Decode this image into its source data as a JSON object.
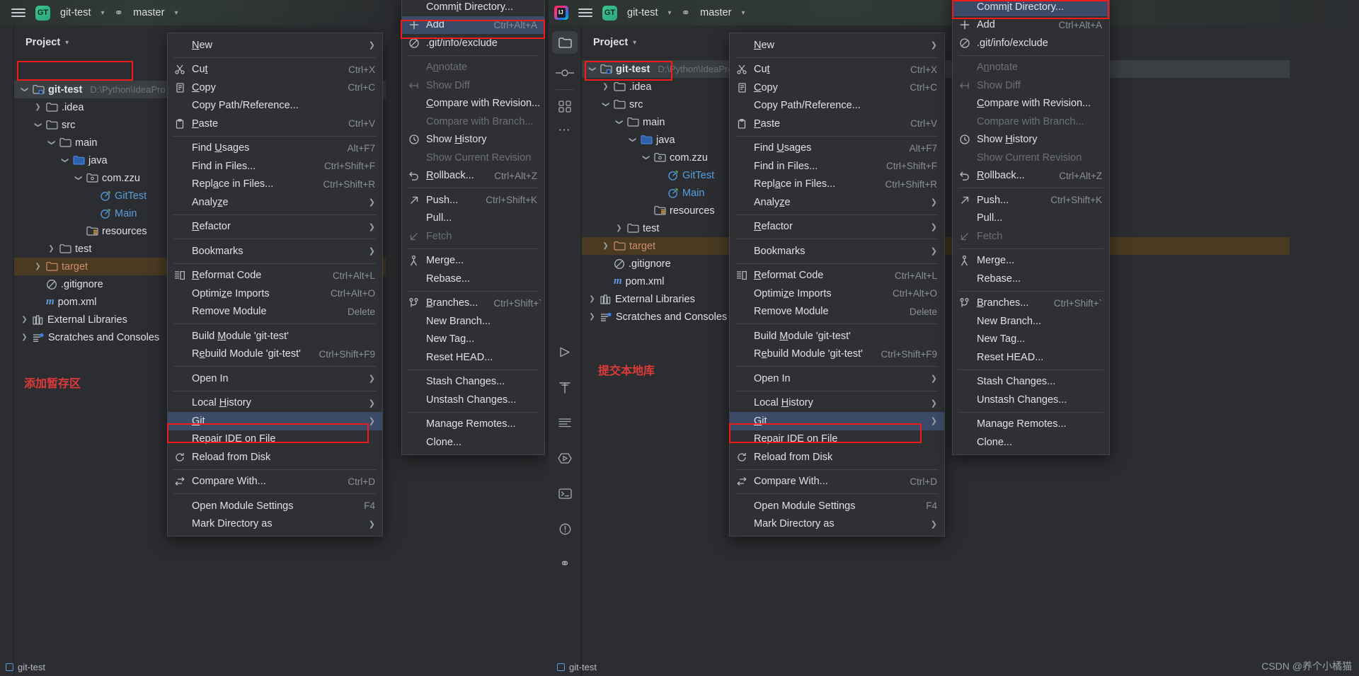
{
  "app": {
    "titlebar": {
      "project": "git-test",
      "branch": "master",
      "hamburger": "hamburger-icon",
      "gt_badge": "GT"
    },
    "panel_title": "Project",
    "status_left": "git-test",
    "status_right": "git-test",
    "watermark": "CSDN @养个小橘猫"
  },
  "annotations": {
    "left_note": "添加暂存区",
    "right_note": "提交本地库"
  },
  "tree": [
    {
      "indent": 0,
      "arrow": "v",
      "icon": "module-folder-icon",
      "label": "git-test",
      "path": "D:\\Python\\IdeaPro",
      "bold": true,
      "state": "selected-grey"
    },
    {
      "indent": 1,
      "arrow": ">",
      "icon": "folder-icon",
      "label": ".idea",
      "path": "",
      "bold": false,
      "state": ""
    },
    {
      "indent": 1,
      "arrow": "v",
      "icon": "folder-icon",
      "label": "src",
      "path": "",
      "bold": false,
      "state": ""
    },
    {
      "indent": 2,
      "arrow": "v",
      "icon": "folder-icon",
      "label": "main",
      "path": "",
      "bold": false,
      "state": ""
    },
    {
      "indent": 3,
      "arrow": "v",
      "icon": "source-folder-icon",
      "label": "java",
      "path": "",
      "bold": false,
      "state": ""
    },
    {
      "indent": 4,
      "arrow": "v",
      "icon": "package-icon",
      "label": "com.zzu",
      "path": "",
      "bold": false,
      "state": ""
    },
    {
      "indent": 5,
      "arrow": "",
      "icon": "java-class-icon",
      "label": "GitTest",
      "path": "",
      "bold": false,
      "state": "class"
    },
    {
      "indent": 5,
      "arrow": "",
      "icon": "java-class-icon",
      "label": "Main",
      "path": "",
      "bold": false,
      "state": "class"
    },
    {
      "indent": 4,
      "arrow": "",
      "icon": "resources-folder-icon",
      "label": "resources",
      "path": "",
      "bold": false,
      "state": ""
    },
    {
      "indent": 2,
      "arrow": ">",
      "icon": "folder-icon",
      "label": "test",
      "path": "",
      "bold": false,
      "state": ""
    },
    {
      "indent": 1,
      "arrow": ">",
      "icon": "excluded-folder-icon",
      "label": "target",
      "path": "",
      "bold": false,
      "state": "selected-brown"
    },
    {
      "indent": 1,
      "arrow": "",
      "icon": "gitignore-icon",
      "label": ".gitignore",
      "path": "",
      "bold": false,
      "state": ""
    },
    {
      "indent": 1,
      "arrow": "",
      "icon": "maven-icon",
      "label": "pom.xml",
      "path": "",
      "bold": false,
      "state": ""
    },
    {
      "indent": 0,
      "arrow": ">",
      "icon": "library-icon",
      "label": "External Libraries",
      "path": "",
      "bold": false,
      "state": ""
    },
    {
      "indent": 0,
      "arrow": ">",
      "icon": "scratches-icon",
      "label": "Scratches and Consoles",
      "path": "",
      "bold": false,
      "state": ""
    }
  ],
  "context_menu": [
    {
      "icon": "",
      "label": "New",
      "mnemonic": "N",
      "shortcut": "",
      "submenu": true,
      "disabled": false
    },
    {
      "type": "separator"
    },
    {
      "icon": "scissors-icon",
      "label": "Cut",
      "mnemonic": "t",
      "shortcut": "Ctrl+X",
      "submenu": false,
      "disabled": false
    },
    {
      "icon": "copy-icon",
      "label": "Copy",
      "mnemonic": "C",
      "shortcut": "Ctrl+C",
      "submenu": false,
      "disabled": false
    },
    {
      "icon": "",
      "label": "Copy Path/Reference...",
      "mnemonic": "",
      "shortcut": "",
      "submenu": false,
      "disabled": false
    },
    {
      "icon": "paste-icon",
      "label": "Paste",
      "mnemonic": "P",
      "shortcut": "Ctrl+V",
      "submenu": false,
      "disabled": false
    },
    {
      "type": "separator"
    },
    {
      "icon": "",
      "label": "Find Usages",
      "mnemonic": "U",
      "shortcut": "Alt+F7",
      "submenu": false,
      "disabled": false
    },
    {
      "icon": "",
      "label": "Find in Files...",
      "mnemonic": "",
      "shortcut": "Ctrl+Shift+F",
      "submenu": false,
      "disabled": false
    },
    {
      "icon": "",
      "label": "Replace in Files...",
      "mnemonic": "a",
      "shortcut": "Ctrl+Shift+R",
      "submenu": false,
      "disabled": false
    },
    {
      "icon": "",
      "label": "Analyze",
      "mnemonic": "z",
      "shortcut": "",
      "submenu": true,
      "disabled": false
    },
    {
      "type": "separator"
    },
    {
      "icon": "",
      "label": "Refactor",
      "mnemonic": "R",
      "shortcut": "",
      "submenu": true,
      "disabled": false
    },
    {
      "type": "separator"
    },
    {
      "icon": "",
      "label": "Bookmarks",
      "mnemonic": "",
      "shortcut": "",
      "submenu": true,
      "disabled": false
    },
    {
      "type": "separator"
    },
    {
      "icon": "reformat-icon",
      "label": "Reformat Code",
      "mnemonic": "R",
      "shortcut": "Ctrl+Alt+L",
      "submenu": false,
      "disabled": false
    },
    {
      "icon": "",
      "label": "Optimize Imports",
      "mnemonic": "z",
      "shortcut": "Ctrl+Alt+O",
      "submenu": false,
      "disabled": false
    },
    {
      "icon": "",
      "label": "Remove Module",
      "mnemonic": "",
      "shortcut": "Delete",
      "submenu": false,
      "disabled": false
    },
    {
      "type": "separator"
    },
    {
      "icon": "",
      "label": "Build Module 'git-test'",
      "mnemonic": "M",
      "shortcut": "",
      "submenu": false,
      "disabled": false
    },
    {
      "icon": "",
      "label": "Rebuild Module 'git-test'",
      "mnemonic": "e",
      "shortcut": "Ctrl+Shift+F9",
      "submenu": false,
      "disabled": false
    },
    {
      "type": "separator"
    },
    {
      "icon": "",
      "label": "Open In",
      "mnemonic": "",
      "shortcut": "",
      "submenu": true,
      "disabled": false
    },
    {
      "type": "separator"
    },
    {
      "icon": "",
      "label": "Local History",
      "mnemonic": "H",
      "shortcut": "",
      "submenu": true,
      "disabled": false
    },
    {
      "icon": "",
      "label": "Git",
      "mnemonic": "G",
      "shortcut": "",
      "submenu": true,
      "disabled": false,
      "highlight": true
    },
    {
      "icon": "",
      "label": "Repair IDE on File",
      "mnemonic": "",
      "shortcut": "",
      "submenu": false,
      "disabled": false
    },
    {
      "icon": "reload-icon",
      "label": "Reload from Disk",
      "mnemonic": "",
      "shortcut": "",
      "submenu": false,
      "disabled": false
    },
    {
      "type": "separator"
    },
    {
      "icon": "compare-icon",
      "label": "Compare With...",
      "mnemonic": "",
      "shortcut": "Ctrl+D",
      "submenu": false,
      "disabled": false
    },
    {
      "type": "separator"
    },
    {
      "icon": "",
      "label": "Open Module Settings",
      "mnemonic": "",
      "shortcut": "F4",
      "submenu": false,
      "disabled": false
    },
    {
      "icon": "",
      "label": "Mark Directory as",
      "mnemonic": "",
      "shortcut": "",
      "submenu": true,
      "disabled": false
    }
  ],
  "git_submenu": [
    {
      "icon": "",
      "label": "Commit Directory...",
      "mnemonic": "i",
      "shortcut": "",
      "disabled": false
    },
    {
      "icon": "plus-icon",
      "label": "Add",
      "mnemonic": "",
      "shortcut": "Ctrl+Alt+A",
      "disabled": false,
      "highlight": true
    },
    {
      "icon": "ignore-icon",
      "label": ".git/info/exclude",
      "mnemonic": "",
      "shortcut": "",
      "disabled": false
    },
    {
      "type": "separator"
    },
    {
      "icon": "",
      "label": "Annotate",
      "mnemonic": "n",
      "shortcut": "",
      "disabled": true
    },
    {
      "icon": "show-diff-icon",
      "label": "Show Diff",
      "mnemonic": "",
      "shortcut": "",
      "disabled": true
    },
    {
      "icon": "",
      "label": "Compare with Revision...",
      "mnemonic": "C",
      "shortcut": "",
      "disabled": false
    },
    {
      "icon": "",
      "label": "Compare with Branch...",
      "mnemonic": "",
      "shortcut": "",
      "disabled": true
    },
    {
      "icon": "clock-icon",
      "label": "Show History",
      "mnemonic": "H",
      "shortcut": "",
      "disabled": false
    },
    {
      "icon": "",
      "label": "Show Current Revision",
      "mnemonic": "",
      "shortcut": "",
      "disabled": true
    },
    {
      "icon": "rollback-icon",
      "label": "Rollback...",
      "mnemonic": "R",
      "shortcut": "Ctrl+Alt+Z",
      "disabled": false
    },
    {
      "type": "separator"
    },
    {
      "icon": "push-icon",
      "label": "Push...",
      "mnemonic": "",
      "shortcut": "Ctrl+Shift+K",
      "disabled": false
    },
    {
      "icon": "",
      "label": "Pull...",
      "mnemonic": "",
      "shortcut": "",
      "disabled": false
    },
    {
      "icon": "fetch-icon",
      "label": "Fetch",
      "mnemonic": "",
      "shortcut": "",
      "disabled": true
    },
    {
      "type": "separator"
    },
    {
      "icon": "merge-icon",
      "label": "Merge...",
      "mnemonic": "",
      "shortcut": "",
      "disabled": false
    },
    {
      "icon": "",
      "label": "Rebase...",
      "mnemonic": "",
      "shortcut": "",
      "disabled": false
    },
    {
      "type": "separator"
    },
    {
      "icon": "branch-icon",
      "label": "Branches...",
      "mnemonic": "B",
      "shortcut": "Ctrl+Shift+`",
      "disabled": false
    },
    {
      "icon": "",
      "label": "New Branch...",
      "mnemonic": "",
      "shortcut": "",
      "disabled": false
    },
    {
      "icon": "",
      "label": "New Tag...",
      "mnemonic": "",
      "shortcut": "",
      "disabled": false
    },
    {
      "icon": "",
      "label": "Reset HEAD...",
      "mnemonic": "",
      "shortcut": "",
      "disabled": false
    },
    {
      "type": "separator"
    },
    {
      "icon": "",
      "label": "Stash Changes...",
      "mnemonic": "",
      "shortcut": "",
      "disabled": false
    },
    {
      "icon": "",
      "label": "Unstash Changes...",
      "mnemonic": "",
      "shortcut": "",
      "disabled": false
    },
    {
      "type": "separator"
    },
    {
      "icon": "",
      "label": "Manage Remotes...",
      "mnemonic": "",
      "shortcut": "",
      "disabled": false
    },
    {
      "icon": "",
      "label": "Clone...",
      "mnemonic": "",
      "shortcut": "",
      "disabled": false
    }
  ],
  "toolbar_icons": [
    "project-folder-icon",
    "commit-icon",
    "structure-icon",
    "more-icon",
    "run-icon",
    "build-icon",
    "todo-icon",
    "services-icon",
    "terminal-icon",
    "problems-icon",
    "git-branch-icon"
  ],
  "colors": {
    "menu_bg": "#2f3033",
    "highlight": "#3b4a66",
    "redbox": "#f01b1b",
    "panel_bg": "#2b2d30",
    "selected_grey": "#3c3f41",
    "selected_brown": "#4a3a22",
    "orange": "#cf8e6d",
    "blue": "#57a0e0",
    "note_red": "#e03a3a"
  }
}
